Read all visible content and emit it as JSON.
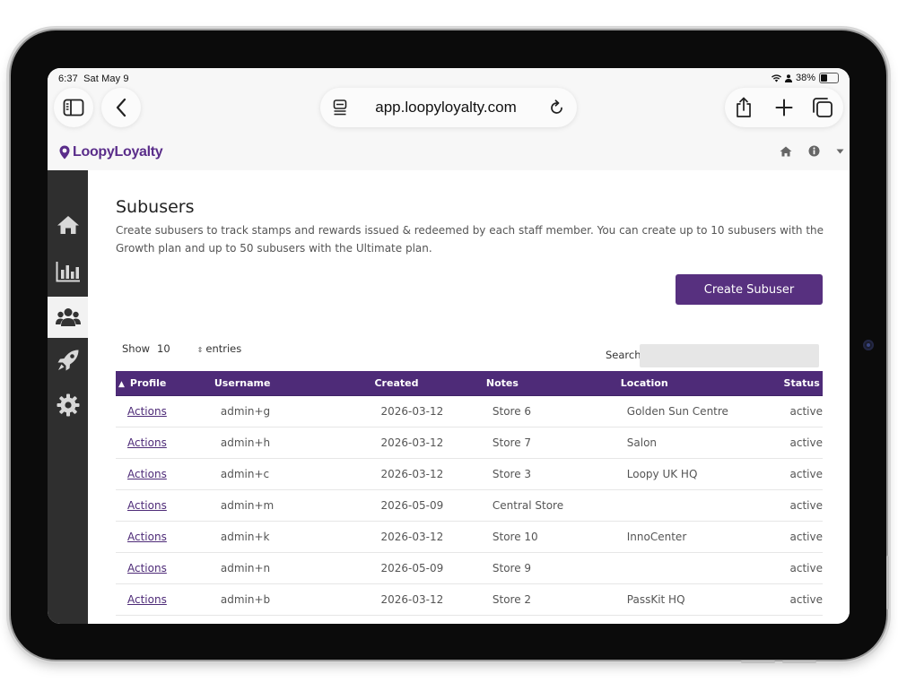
{
  "status_bar": {
    "time": "6:37",
    "date": "Sat May 9",
    "battery": "38%",
    "battery_level": 0.38
  },
  "browser": {
    "url": "app.loopyloyalty.com",
    "icons": [
      "sidebar-icon",
      "back-icon",
      "reader-icon",
      "reload-icon",
      "share-icon",
      "new-tab-icon",
      "tabs-icon"
    ]
  },
  "app": {
    "logo_text": "LoopyLoyalty",
    "brand_color": "#57307f",
    "header_icons": [
      "home-icon",
      "info-icon",
      "caret-down-icon"
    ]
  },
  "sidebar": {
    "items": [
      {
        "name": "home",
        "icon": "home-icon",
        "active": false
      },
      {
        "name": "analytics",
        "icon": "bar-chart-icon",
        "active": false
      },
      {
        "name": "subusers",
        "icon": "users-icon",
        "active": true
      },
      {
        "name": "campaigns",
        "icon": "rocket-icon",
        "active": false
      },
      {
        "name": "settings",
        "icon": "gear-icon",
        "active": false
      }
    ]
  },
  "page": {
    "title": "Subusers",
    "description": "Create subusers to track stamps and rewards issued & redeemed by each staff member. You can create up to 10 subusers with the Growth plan and up to 50 subusers with the Ultimate plan.",
    "create_button": "Create Subuser"
  },
  "table_controls": {
    "show_label": "Show",
    "page_size": "10",
    "entries_label": "entries",
    "search_label": "Search:",
    "search_value": ""
  },
  "table": {
    "sort_indicator": "▲",
    "columns": [
      "Profile",
      "Username",
      "Created",
      "Notes",
      "Location",
      "Status"
    ],
    "rows": [
      {
        "profile": "Actions",
        "username": "admin+g",
        "created": "2026-03-12",
        "notes": "Store 6",
        "location": "Golden Sun Centre",
        "status": "active"
      },
      {
        "profile": "Actions",
        "username": "admin+h",
        "created": "2026-03-12",
        "notes": "Store 7",
        "location": "Salon",
        "status": "active"
      },
      {
        "profile": "Actions",
        "username": "admin+c",
        "created": "2026-03-12",
        "notes": "Store 3",
        "location": "Loopy UK HQ",
        "status": "active"
      },
      {
        "profile": "Actions",
        "username": "admin+m",
        "created": "2026-05-09",
        "notes": "Central Store",
        "location": "",
        "status": "active"
      },
      {
        "profile": "Actions",
        "username": "admin+k",
        "created": "2026-03-12",
        "notes": "Store 10",
        "location": "InnoCenter",
        "status": "active"
      },
      {
        "profile": "Actions",
        "username": "admin+n",
        "created": "2026-05-09",
        "notes": "Store 9",
        "location": "",
        "status": "active"
      },
      {
        "profile": "Actions",
        "username": "admin+b",
        "created": "2026-03-12",
        "notes": "Store 2",
        "location": "PassKit HQ",
        "status": "active"
      }
    ]
  }
}
